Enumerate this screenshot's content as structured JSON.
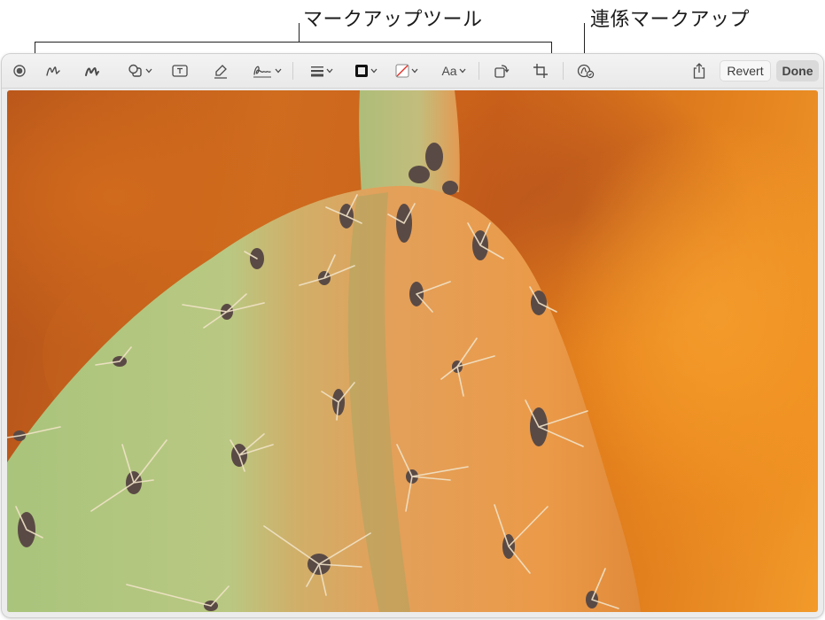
{
  "callouts": {
    "markup_tools": "マークアップツール",
    "continuity_markup": "連係マークアップ"
  },
  "toolbar": {
    "buttons": [
      {
        "name": "record-icon",
        "kind": "record"
      },
      {
        "name": "sketch-icon",
        "kind": "sketch"
      },
      {
        "name": "draw-icon",
        "kind": "draw"
      },
      {
        "name": "shapes-icon",
        "kind": "shapes"
      },
      {
        "name": "text-box-icon",
        "kind": "text"
      },
      {
        "name": "highlight-icon",
        "kind": "highlight"
      },
      {
        "name": "signature-icon",
        "kind": "signature"
      },
      {
        "name": "shape-style-icon",
        "kind": "lines"
      },
      {
        "name": "border-color-icon",
        "kind": "border"
      },
      {
        "name": "fill-color-icon",
        "kind": "fill"
      },
      {
        "name": "rotate-icon",
        "kind": "rotate"
      },
      {
        "name": "crop-icon",
        "kind": "crop"
      },
      {
        "name": "continuity-markup-icon",
        "kind": "continuity"
      },
      {
        "name": "share-icon",
        "kind": "share"
      }
    ],
    "text_style_label": "Aa",
    "revert_label": "Revert",
    "done_label": "Done"
  },
  "colors": {
    "toolbar_bg": "#ececec",
    "icon": "#4a4a4a",
    "cactus_green": "#9fbf72",
    "cactus_sunlit": "#e0a155",
    "background_orange": "#d9741e"
  }
}
